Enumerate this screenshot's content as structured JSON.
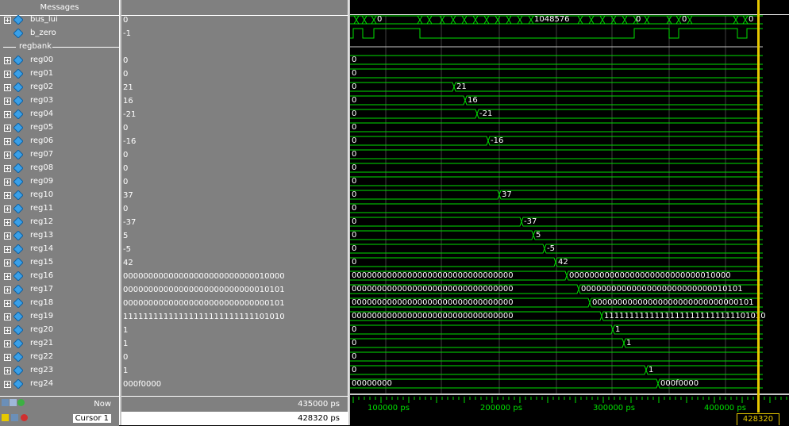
{
  "header": {
    "messages_label": "Messages"
  },
  "top_signals": [
    {
      "name": "bus_lui",
      "value": "0"
    },
    {
      "name": "b_zero",
      "value": "-1"
    }
  ],
  "group": {
    "name": "regbank"
  },
  "registers": [
    {
      "name": "reg00",
      "value": "0"
    },
    {
      "name": "reg01",
      "value": "0"
    },
    {
      "name": "reg02",
      "value": "21"
    },
    {
      "name": "reg03",
      "value": "16"
    },
    {
      "name": "reg04",
      "value": "-21"
    },
    {
      "name": "reg05",
      "value": "0"
    },
    {
      "name": "reg06",
      "value": "-16"
    },
    {
      "name": "reg07",
      "value": "0"
    },
    {
      "name": "reg08",
      "value": "0"
    },
    {
      "name": "reg09",
      "value": "0"
    },
    {
      "name": "reg10",
      "value": "37"
    },
    {
      "name": "reg11",
      "value": "0"
    },
    {
      "name": "reg12",
      "value": "-37"
    },
    {
      "name": "reg13",
      "value": "5"
    },
    {
      "name": "reg14",
      "value": "-5"
    },
    {
      "name": "reg15",
      "value": "42"
    },
    {
      "name": "reg16",
      "value": "00000000000000000000000000010000"
    },
    {
      "name": "reg17",
      "value": "00000000000000000000000000010101"
    },
    {
      "name": "reg18",
      "value": "00000000000000000000000000000101"
    },
    {
      "name": "reg19",
      "value": "11111111111111111111111111101010"
    },
    {
      "name": "reg20",
      "value": "1"
    },
    {
      "name": "reg21",
      "value": "1"
    },
    {
      "name": "reg22",
      "value": "0"
    },
    {
      "name": "reg23",
      "value": "1"
    },
    {
      "name": "reg24",
      "value": "000f0000"
    }
  ],
  "footer": {
    "now_label": "Now",
    "now_value": "435000 ps",
    "cursor_label": "Cursor 1",
    "cursor_value": "428320 ps"
  },
  "waveform": {
    "bus_lui_labels": [
      "0",
      "1048576",
      "0",
      "0",
      "0"
    ],
    "reg_transition_labels": [
      "0",
      "0",
      "21",
      "16",
      "-21",
      "0",
      "-16",
      "0",
      "0",
      "0",
      "37",
      "0",
      "-37",
      "5",
      "-5",
      "42",
      "00000000000000000000000000010000",
      "00000000000000000000000000010101",
      "00000000000000000000000000000101",
      "11111111111111111111111111101010",
      "1",
      "1",
      "0",
      "1",
      "000f0000"
    ],
    "wide_initial": "00000000000000000000000000000000",
    "reg24_initial": "00000000",
    "ruler_labels": [
      "100000 ps",
      "200000 ps",
      "300000 ps",
      "400000 ps"
    ],
    "cursor_tag": "428320 ps",
    "wave_color": "#00e000",
    "cursor_color": "#e6c800"
  }
}
